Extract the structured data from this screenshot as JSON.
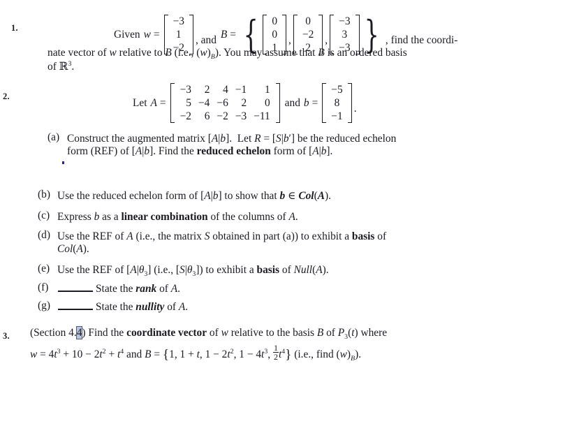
{
  "document": {
    "type": "math-homework-worksheet",
    "background": "#ffffff",
    "text_color": "#1a1a22"
  },
  "problems": [
    {
      "number": "1.",
      "lead": "Given",
      "w_symbol": "w",
      "equals": "=",
      "w_vector": [
        "−3",
        "1",
        "−2"
      ],
      "mid_text": ", and",
      "B_symbol": "B",
      "B_vectors": [
        [
          "0",
          "0",
          "1"
        ],
        [
          "0",
          "−2",
          "2"
        ],
        [
          "−3",
          "3",
          "−3"
        ]
      ],
      "tail_text": ", find the coordi-",
      "continuation_line_1": "nate vector of w relative to B (i.e., (w)B). You may assume that B is an ordered basis",
      "continuation_line_2": "of R3."
    },
    {
      "number": "2.",
      "let_text": "Let",
      "A_symbol": "A",
      "equals": "=",
      "A_matrix": [
        [
          "−3",
          "2",
          "4",
          "−1",
          "1"
        ],
        [
          "5",
          "−4",
          "−6",
          "2",
          "0"
        ],
        [
          "−2",
          "6",
          "−2",
          "−3",
          "−11"
        ]
      ],
      "and_text": "and",
      "b_symbol": "b",
      "b_vector": [
        "−5",
        "8",
        "−1"
      ],
      "period": ".",
      "parts": [
        {
          "label": "(a)",
          "line1": "Construct the augmented matrix [A|b].  Let R = [S|b′] be the reduced echelon",
          "line2": "form (REF) of [A|b]. Find the reduced echelon form of [A|b].",
          "bold_terms": [
            "reduced echelon"
          ]
        },
        {
          "label": "(b)",
          "line1": "Use the reduced echelon form of [A|b] to show that b ∈ Col(A).",
          "bold_terms": [
            "b",
            "Col(A)"
          ]
        },
        {
          "label": "(c)",
          "line1": "Express b as a linear combination of the columns of A.",
          "bold_terms": [
            "linear combination"
          ]
        },
        {
          "label": "(d)",
          "line1": "Use the REF of A (i.e., the matrix S obtained in part (a)) to exhibit a basis of",
          "line2": "Col(A).",
          "bold_terms": [
            "basis"
          ]
        },
        {
          "label": "(e)",
          "line1": "Use the REF of [A|θ3] (i.e., [S|θ3]) to exhibit a basis of Null(A).",
          "bold_terms": [
            "basis"
          ]
        },
        {
          "label": "(f)",
          "blank": true,
          "line1": "State the rank of A.",
          "bold_terms": [
            "rank"
          ]
        },
        {
          "label": "(g)",
          "blank": true,
          "line1": "State the nullity of A.",
          "bold_terms": [
            "nullity"
          ]
        }
      ]
    },
    {
      "number": "3.",
      "section_prefix": "(Section 4.",
      "section_highlighted_char": "4",
      "section_suffix": ")",
      "line1_rest": "Find the coordinate vector of w relative to the basis B of P3(t) where",
      "line2": "w = 4t3 + 10 − 2t2 + t4 and B = {1, 1 + t, 1 − 2t2, 1 − 4t3, ½t4} (i.e., find (w)B).",
      "bold_terms": [
        "coordinate vector"
      ]
    }
  ],
  "annotations": {
    "selection_highlight_color": "#b9c4dd",
    "selection_border_color": "#4a5c86",
    "stray_cursor_color": "#2222aa"
  }
}
